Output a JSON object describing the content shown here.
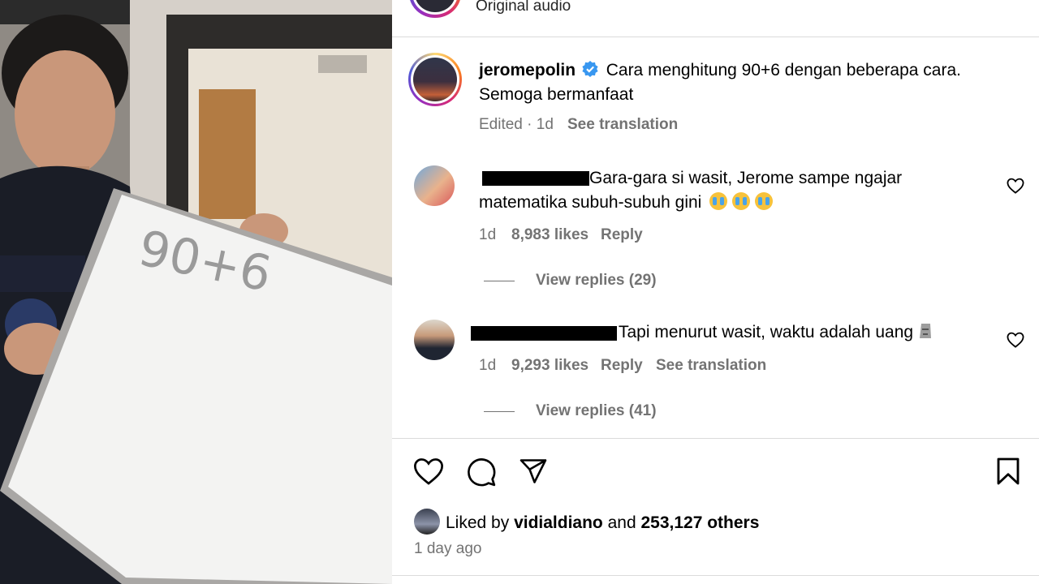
{
  "video": {
    "board_text": "90+6"
  },
  "header": {
    "audio_label": "Original audio"
  },
  "caption": {
    "username": "jeromepolin",
    "text_line1": "Cara menghitung 90+6 dengan beberapa cara.",
    "text_line2": "Semoga bermanfaat",
    "edited": "Edited · 1d",
    "see_translation": "See translation"
  },
  "comments": [
    {
      "text_line1": "Gara-gara si wasit, Jerome sampe ngajar",
      "text_line2": "matematika subuh-subuh gini",
      "time": "1d",
      "likes": "8,983 likes",
      "reply": "Reply",
      "view_replies": "View replies (29)"
    },
    {
      "text": "Tapi menurut wasit, waktu adalah uang",
      "time": "1d",
      "likes": "9,293 likes",
      "reply": "Reply",
      "see_translation": "See translation",
      "view_replies": "View replies (41)"
    }
  ],
  "likes_section": {
    "prefix": "Liked by",
    "liker": "vidialdiano",
    "and": "and",
    "others": "253,127 others",
    "time_ago": "1 day ago"
  },
  "icons": {
    "like": "heart-icon",
    "comment": "comment-icon",
    "share": "paper-plane-icon",
    "save": "bookmark-icon",
    "verified": "verified-badge-icon"
  },
  "colors": {
    "verified": "#3897f0",
    "muted": "#737373",
    "divider": "#dbdbdb"
  }
}
